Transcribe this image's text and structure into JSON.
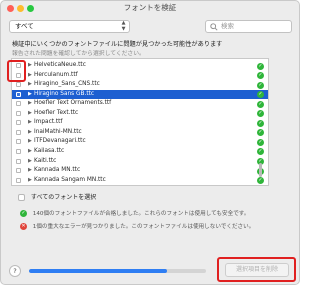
{
  "window": {
    "title": "フォントを検証",
    "traffic_colors": [
      "#ff5f57",
      "#febc2e",
      "#28c840"
    ]
  },
  "toolbar": {
    "filter_value": "すべて",
    "search_placeholder": "検索"
  },
  "messages": {
    "warning": "検証中にいくつかのフォントファイルに問題が見つかった可能性があります",
    "hint": "報告された問題を確認してから選択してください。"
  },
  "font_list": {
    "items": [
      {
        "name": "HelveticaNeue.ttc",
        "selected": false
      },
      {
        "name": "Herculanum.ttf",
        "selected": false
      },
      {
        "name": "Hiragino_Sans_CNS.ttc",
        "selected": false
      },
      {
        "name": "Hiragino Sans GB.ttc",
        "selected": true
      },
      {
        "name": "Hoefler Text Ornaments.ttf",
        "selected": false
      },
      {
        "name": "Hoefler Text.ttc",
        "selected": false
      },
      {
        "name": "Impact.ttf",
        "selected": false
      },
      {
        "name": "InaiMathi-MN.ttc",
        "selected": false
      },
      {
        "name": "ITFDevanagari.ttc",
        "selected": false
      },
      {
        "name": "Kailasa.ttc",
        "selected": false
      },
      {
        "name": "Kaiti.ttc",
        "selected": false
      },
      {
        "name": "Kannada MN.ttc",
        "selected": false
      },
      {
        "name": "Kannada Sangam MN.ttc",
        "selected": false
      }
    ],
    "status_color": "#2fb53a",
    "selection_color": "#1d5fd1"
  },
  "select_all_label": "すべてのフォントを選択",
  "summary": {
    "passed": "140個のフォントファイルが合格しました。これらのフォントは使用しても安全です。",
    "failed": "1個の重大なエラーが見つかりました。このフォントファイルは使用しないでください。"
  },
  "footer": {
    "help_label": "?",
    "progress": 0.78,
    "remove_button": "選択項目を削除"
  },
  "annotation_color": "#e02020"
}
